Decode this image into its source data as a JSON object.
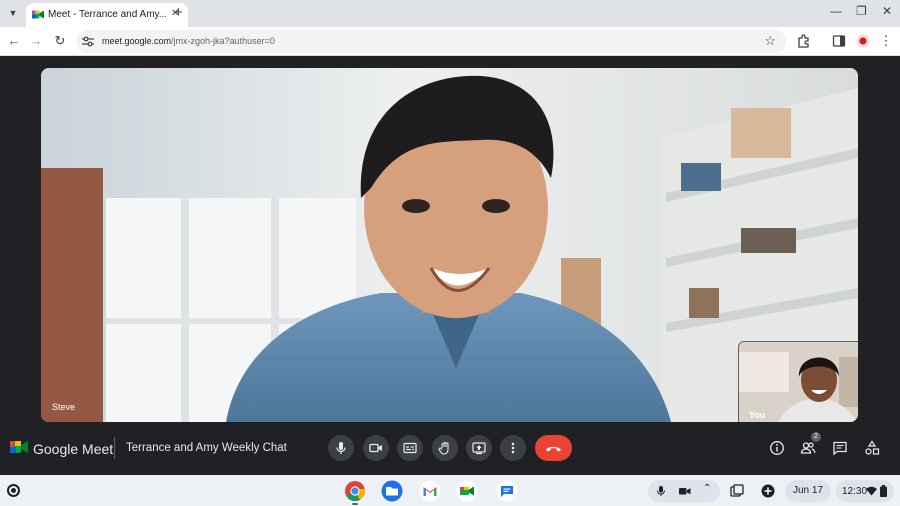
{
  "browser": {
    "tab_title": "Meet - Terrance and Amy...",
    "tab_close": "✕",
    "new_tab": "+",
    "url_host": "meet.google.com",
    "url_path": "/jmx-zgoh-jka?authuser=0"
  },
  "meet": {
    "brand": "Google Meet",
    "meeting_title": "Terrance and Amy Weekly Chat",
    "speaker_name": "Steve",
    "self_name": "You",
    "people_count": "2",
    "self_more": "•••"
  },
  "shelf": {
    "date": "Jun 17",
    "time": "12:30"
  },
  "colors": {
    "end_call": "#ea4335",
    "control_bg": "#3c4043",
    "meet_bg": "#202124",
    "accent": "#1a73e8"
  }
}
